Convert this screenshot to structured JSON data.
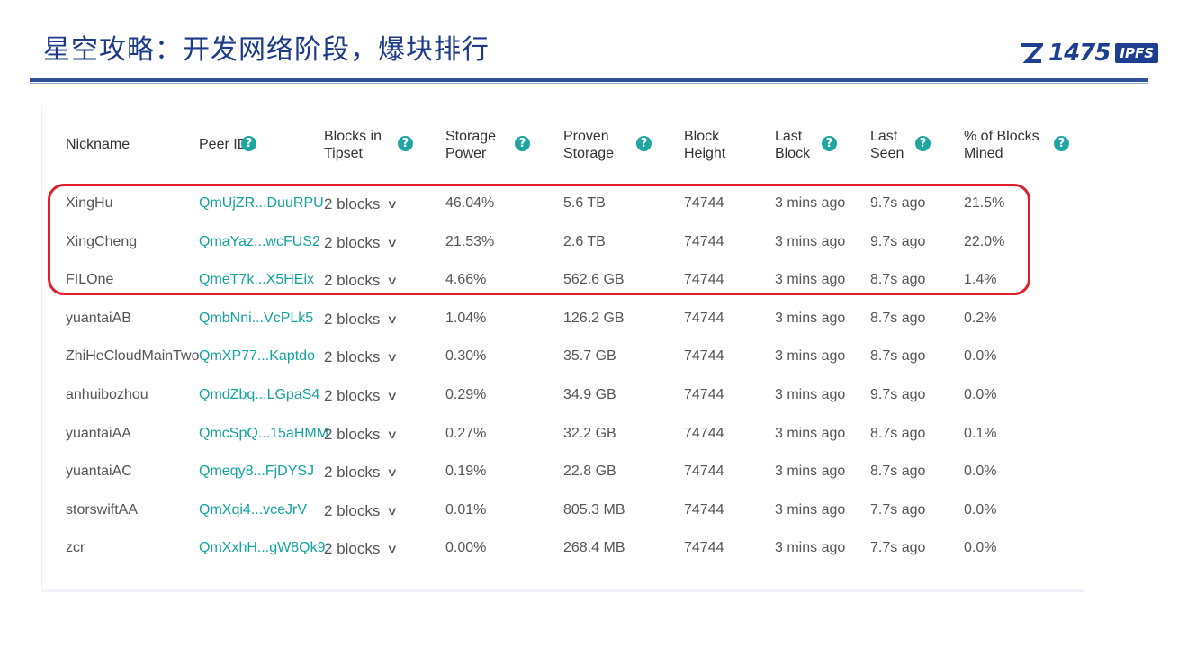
{
  "slide": {
    "title": "星空攻略：开发网络阶段，爆块排行",
    "logo_number": "1475",
    "logo_badge": "IPFS",
    "colors": {
      "title": "#1e3a8a",
      "peer_link": "#13a3a0",
      "help_icon": "#1fa6a3",
      "highlight": "#e01e2b"
    }
  },
  "table": {
    "headers": {
      "nickname": "Nickname",
      "peer_id": "Peer ID",
      "blocks_tipset_1": "Blocks in",
      "blocks_tipset_2": "Tipset",
      "storage_power_1": "Storage",
      "storage_power_2": "Power",
      "proven_storage_1": "Proven",
      "proven_storage_2": "Storage",
      "block_height_1": "Block",
      "block_height_2": "Height",
      "last_block_1": "Last",
      "last_block_2": "Block",
      "last_seen_1": "Last",
      "last_seen_2": "Seen",
      "pct_mined_1": "% of Blocks",
      "pct_mined_2": "Mined"
    },
    "help_glyph": "?",
    "chevron_glyph": "∨",
    "rows": [
      {
        "nickname": "XingHu",
        "peer_id": "QmUjZR...DuuRPU",
        "blocks": "2 blocks",
        "power": "46.04%",
        "proven": "5.6 TB",
        "height": "74744",
        "last_block": "3 mins ago",
        "last_seen": "9.7s ago",
        "mined": "21.5%"
      },
      {
        "nickname": "XingCheng",
        "peer_id": "QmaYaz...wcFUS2",
        "blocks": "2 blocks",
        "power": "21.53%",
        "proven": "2.6 TB",
        "height": "74744",
        "last_block": "3 mins ago",
        "last_seen": "9.7s ago",
        "mined": "22.0%"
      },
      {
        "nickname": "FILOne",
        "peer_id": "QmeT7k...X5HEix",
        "blocks": "2 blocks",
        "power": "4.66%",
        "proven": "562.6 GB",
        "height": "74744",
        "last_block": "3 mins ago",
        "last_seen": "8.7s ago",
        "mined": "1.4%"
      },
      {
        "nickname": "yuantaiAB",
        "peer_id": "QmbNni...VcPLk5",
        "blocks": "2 blocks",
        "power": "1.04%",
        "proven": "126.2 GB",
        "height": "74744",
        "last_block": "3 mins ago",
        "last_seen": "8.7s ago",
        "mined": "0.2%"
      },
      {
        "nickname": "ZhiHeCloudMainTwo",
        "peer_id": "QmXP77...Kaptdo",
        "blocks": "2 blocks",
        "power": "0.30%",
        "proven": "35.7 GB",
        "height": "74744",
        "last_block": "3 mins ago",
        "last_seen": "8.7s ago",
        "mined": "0.0%"
      },
      {
        "nickname": "anhuibozhou",
        "peer_id": "QmdZbq...LGpaS4",
        "blocks": "2 blocks",
        "power": "0.29%",
        "proven": "34.9 GB",
        "height": "74744",
        "last_block": "3 mins ago",
        "last_seen": "9.7s ago",
        "mined": "0.0%"
      },
      {
        "nickname": "yuantaiAA",
        "peer_id": "QmcSpQ...15aHMM",
        "blocks": "2 blocks",
        "power": "0.27%",
        "proven": "32.2 GB",
        "height": "74744",
        "last_block": "3 mins ago",
        "last_seen": "8.7s ago",
        "mined": "0.1%"
      },
      {
        "nickname": "yuantaiAC",
        "peer_id": "Qmeqy8...FjDYSJ",
        "blocks": "2 blocks",
        "power": "0.19%",
        "proven": "22.8 GB",
        "height": "74744",
        "last_block": "3 mins ago",
        "last_seen": "8.7s ago",
        "mined": "0.0%"
      },
      {
        "nickname": "storswiftAA",
        "peer_id": "QmXqi4...vceJrV",
        "blocks": "2 blocks",
        "power": "0.01%",
        "proven": "805.3 MB",
        "height": "74744",
        "last_block": "3 mins ago",
        "last_seen": "7.7s ago",
        "mined": "0.0%"
      },
      {
        "nickname": "zcr",
        "peer_id": "QmXxhH...gW8Qk9",
        "blocks": "2 blocks",
        "power": "0.00%",
        "proven": "268.4 MB",
        "height": "74744",
        "last_block": "3 mins ago",
        "last_seen": "7.7s ago",
        "mined": "0.0%"
      }
    ]
  }
}
